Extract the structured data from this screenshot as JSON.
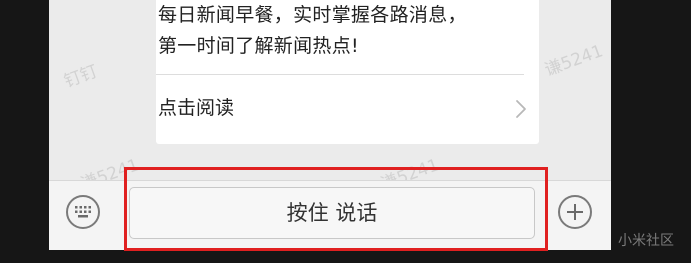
{
  "card": {
    "line1": "每日新闻早餐，实时掌握各路消息，",
    "line2": "第一时间了解新闻热点!",
    "read_label": "点击阅读"
  },
  "input_bar": {
    "talk_label": "按住 说话"
  },
  "watermarks": {
    "dingding": "钉钉",
    "name_1": "谦5241",
    "name_2": "谦5241",
    "name_3": "谦5241"
  },
  "site_watermark": "小米社区",
  "colors": {
    "highlight": "#e02020",
    "chat_background": "#ebebeb",
    "card_background": "#ffffff"
  },
  "icons": {
    "keyboard": "keyboard-icon",
    "plus": "plus-icon",
    "chevron": "chevron-right-icon"
  }
}
